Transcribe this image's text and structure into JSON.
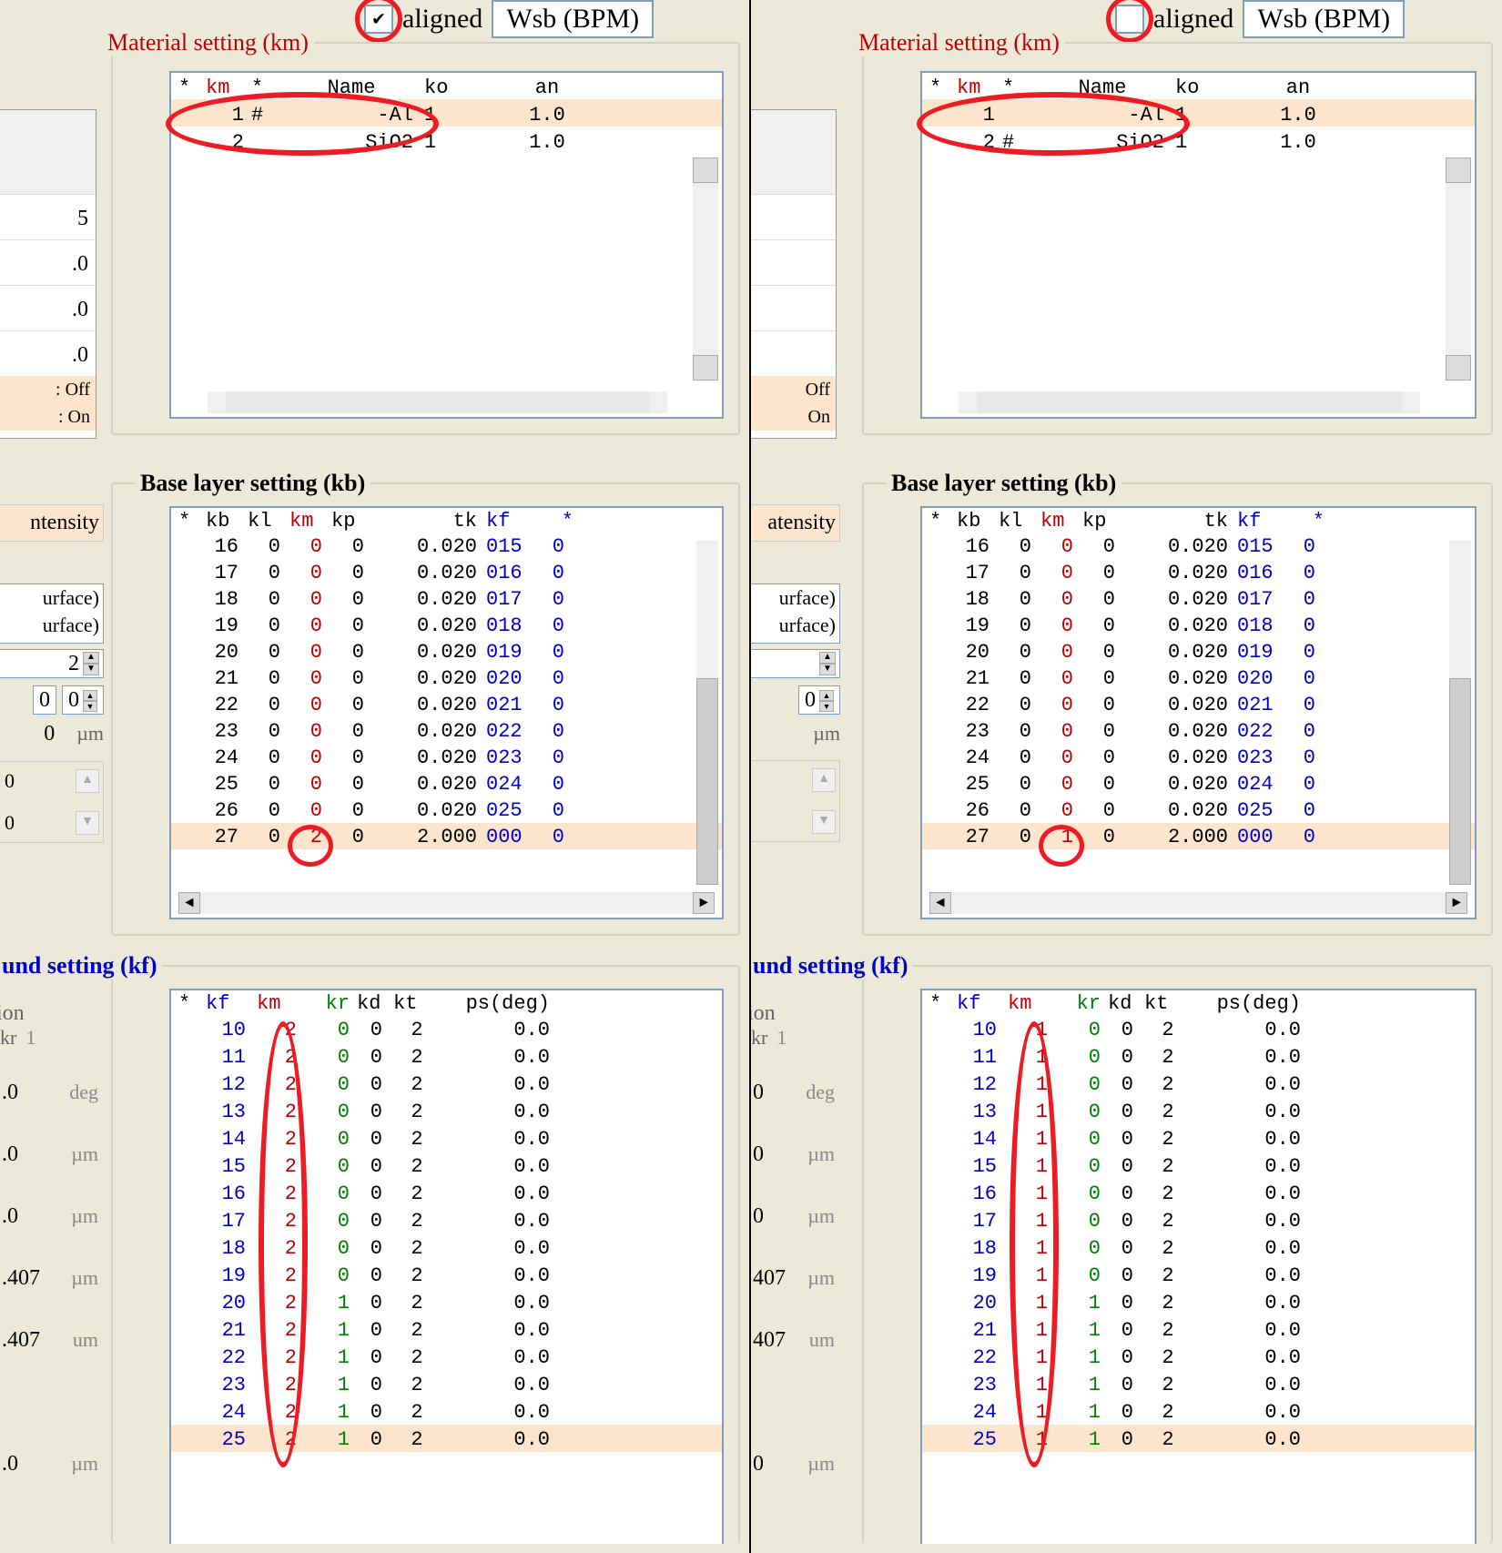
{
  "header": {
    "aligned_label": "aligned",
    "wsb_label": "Wsb (BPM)"
  },
  "material": {
    "title": "Material setting (km)",
    "columns": {
      "star": "*",
      "km": "km",
      "star2": "*",
      "name": "Name",
      "ko": "ko",
      "an": "an"
    },
    "rows": [
      {
        "km": "1",
        "mark_left": "#",
        "mark_right": "",
        "name": "-Al",
        "ko": "1",
        "an": "1.0",
        "sel": true
      },
      {
        "km": "2",
        "mark_left": "",
        "mark_right": "#",
        "name": "SiO2",
        "ko": "1",
        "an": "1.0",
        "sel": false
      }
    ]
  },
  "left_top": {
    "frag0": "",
    "frag1": "5",
    "frag2": ".0",
    "frag3": ".0",
    "frag4": ".0",
    "status_off": ": Off",
    "status_on": ": On"
  },
  "left_top_right": {
    "status_off": "Off",
    "status_on": "On"
  },
  "base": {
    "title": "Base layer setting (kb)",
    "columns": {
      "star": "*",
      "kb": "kb",
      "kl": "kl",
      "km": "km",
      "kp": "kp",
      "tk": "tk",
      "kf": "kf",
      "star2": "*"
    },
    "rows": [
      {
        "kb": "16",
        "kl": "0",
        "km": "0",
        "kp": "0",
        "tk": "0.020",
        "kf": "015",
        "s": "0"
      },
      {
        "kb": "17",
        "kl": "0",
        "km": "0",
        "kp": "0",
        "tk": "0.020",
        "kf": "016",
        "s": "0"
      },
      {
        "kb": "18",
        "kl": "0",
        "km": "0",
        "kp": "0",
        "tk": "0.020",
        "kf": "017",
        "s": "0"
      },
      {
        "kb": "19",
        "kl": "0",
        "km": "0",
        "kp": "0",
        "tk": "0.020",
        "kf": "018",
        "s": "0"
      },
      {
        "kb": "20",
        "kl": "0",
        "km": "0",
        "kp": "0",
        "tk": "0.020",
        "kf": "019",
        "s": "0"
      },
      {
        "kb": "21",
        "kl": "0",
        "km": "0",
        "kp": "0",
        "tk": "0.020",
        "kf": "020",
        "s": "0"
      },
      {
        "kb": "22",
        "kl": "0",
        "km": "0",
        "kp": "0",
        "tk": "0.020",
        "kf": "021",
        "s": "0"
      },
      {
        "kb": "23",
        "kl": "0",
        "km": "0",
        "kp": "0",
        "tk": "0.020",
        "kf": "022",
        "s": "0"
      },
      {
        "kb": "24",
        "kl": "0",
        "km": "0",
        "kp": "0",
        "tk": "0.020",
        "kf": "023",
        "s": "0"
      },
      {
        "kb": "25",
        "kl": "0",
        "km": "0",
        "kp": "0",
        "tk": "0.020",
        "kf": "024",
        "s": "0"
      },
      {
        "kb": "26",
        "kl": "0",
        "km": "0",
        "kp": "0",
        "tk": "0.020",
        "kf": "025",
        "s": "0"
      },
      {
        "kb": "27",
        "kl": "0",
        "km_left": "2",
        "km_right": "1",
        "kp": "0",
        "tk": "2.000",
        "kf": "000",
        "s": "0",
        "sel": true
      }
    ]
  },
  "left_mid": {
    "tensity": "ntensity",
    "tensity_right": "atensity",
    "surface1": "urface)",
    "surface2": "urface)",
    "spin1": "2",
    "spin2a": "0",
    "spin2b": "0",
    "val_um": "0",
    "unit_um": "µm",
    "gb1": "0",
    "gb2": "0"
  },
  "comp": {
    "title": "und setting (kf)",
    "title_right": "und setting (kf)",
    "columns": {
      "star": "*",
      "kf": "kf",
      "km": "km",
      "kr": "kr",
      "kd": "kd",
      "kt": "kt",
      "ps": "ps(deg)"
    },
    "rows": [
      {
        "kf": "10",
        "km_l": "2",
        "km_r": "1",
        "kr": "0",
        "kd": "0",
        "kt": "2",
        "ps": "0.0"
      },
      {
        "kf": "11",
        "km_l": "2",
        "km_r": "1",
        "kr": "0",
        "kd": "0",
        "kt": "2",
        "ps": "0.0"
      },
      {
        "kf": "12",
        "km_l": "2",
        "km_r": "1",
        "kr": "0",
        "kd": "0",
        "kt": "2",
        "ps": "0.0"
      },
      {
        "kf": "13",
        "km_l": "2",
        "km_r": "1",
        "kr": "0",
        "kd": "0",
        "kt": "2",
        "ps": "0.0"
      },
      {
        "kf": "14",
        "km_l": "2",
        "km_r": "1",
        "kr": "0",
        "kd": "0",
        "kt": "2",
        "ps": "0.0"
      },
      {
        "kf": "15",
        "km_l": "2",
        "km_r": "1",
        "kr": "0",
        "kd": "0",
        "kt": "2",
        "ps": "0.0"
      },
      {
        "kf": "16",
        "km_l": "2",
        "km_r": "1",
        "kr": "0",
        "kd": "0",
        "kt": "2",
        "ps": "0.0"
      },
      {
        "kf": "17",
        "km_l": "2",
        "km_r": "1",
        "kr": "0",
        "kd": "0",
        "kt": "2",
        "ps": "0.0"
      },
      {
        "kf": "18",
        "km_l": "2",
        "km_r": "1",
        "kr": "0",
        "kd": "0",
        "kt": "2",
        "ps": "0.0"
      },
      {
        "kf": "19",
        "km_l": "2",
        "km_r": "1",
        "kr": "0",
        "kd": "0",
        "kt": "2",
        "ps": "0.0"
      },
      {
        "kf": "20",
        "km_l": "2",
        "km_r": "1",
        "kr": "1",
        "kd": "0",
        "kt": "2",
        "ps": "0.0"
      },
      {
        "kf": "21",
        "km_l": "2",
        "km_r": "1",
        "kr": "1",
        "kd": "0",
        "kt": "2",
        "ps": "0.0"
      },
      {
        "kf": "22",
        "km_l": "2",
        "km_r": "1",
        "kr": "1",
        "kd": "0",
        "kt": "2",
        "ps": "0.0"
      },
      {
        "kf": "23",
        "km_l": "2",
        "km_r": "1",
        "kr": "1",
        "kd": "0",
        "kt": "2",
        "ps": "0.0"
      },
      {
        "kf": "24",
        "km_l": "2",
        "km_r": "1",
        "kr": "1",
        "kd": "0",
        "kt": "2",
        "ps": "0.0"
      },
      {
        "kf": "25",
        "km_l": "2",
        "km_r": "1",
        "kr": "1",
        "kd": "0",
        "kt": "2",
        "ps": "0.0",
        "sel": true
      }
    ]
  },
  "left_bot": {
    "ion": "ion",
    "kr_label": "kr",
    "kr_val": "1",
    "rows": [
      {
        "v": ".0",
        "u": "deg"
      },
      {
        "v": ".0",
        "u": "µm"
      },
      {
        "v": ".0",
        "u": "µm"
      },
      {
        "v": ".407",
        "u": "µm"
      },
      {
        "v": ".407",
        "u": "um"
      },
      {
        "v": "",
        "u": ""
      },
      {
        "v": ".0",
        "u": "µm"
      }
    ],
    "rows_right": [
      {
        "v": "0",
        "u": "deg"
      },
      {
        "v": "0",
        "u": "µm"
      },
      {
        "v": "0",
        "u": "µm"
      },
      {
        "v": "407",
        "u": "µm"
      },
      {
        "v": "407",
        "u": "um"
      },
      {
        "v": "",
        "u": ""
      },
      {
        "v": "0",
        "u": "µm"
      }
    ]
  },
  "icons": {
    "back": "←",
    "up": "▲",
    "down": "▼",
    "close": "✕",
    "check": "✔"
  }
}
